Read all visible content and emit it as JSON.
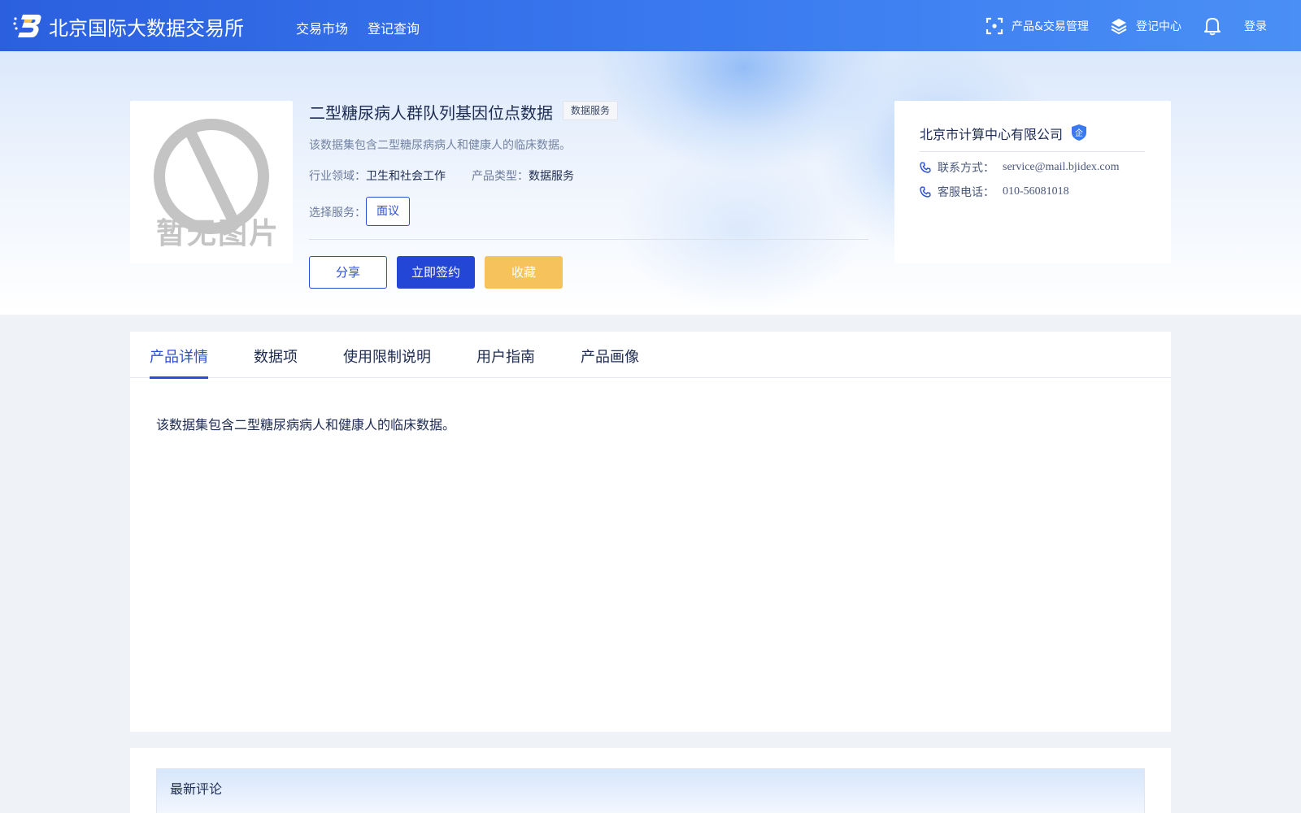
{
  "header": {
    "brand": "北京国际大数据交易所",
    "nav": [
      "交易市场",
      "登记查询"
    ],
    "right": {
      "product_mgmt": "产品&交易管理",
      "register_center": "登记中心",
      "login": "登录"
    }
  },
  "product": {
    "title": "二型糖尿病人群队列基因位点数据",
    "tag": "数据服务",
    "description": "该数据集包含二型糖尿病病人和健康人的临床数据。",
    "no_image_text": "暂无图片",
    "industry_label": "行业领域：",
    "industry_value": "卫生和社会工作",
    "type_label": "产品类型：",
    "type_value": "数据服务",
    "service_label": "选择服务：",
    "service_option": "面议",
    "buttons": {
      "share": "分享",
      "sign": "立即签约",
      "favorite": "收藏"
    }
  },
  "seller": {
    "name": "北京市计算中心有限公司",
    "badge_char": "企",
    "contact_label": "联系方式：",
    "contact_value": "service@mail.bjidex.com",
    "phone_label": "客服电话：",
    "phone_value": "010-56081018"
  },
  "tabs": {
    "items": [
      "产品详情",
      "数据项",
      "使用限制说明",
      "用户指南",
      "产品画像"
    ],
    "active_index": 0
  },
  "detail": {
    "text": "该数据集包含二型糖尿病病人和健康人的临床数据。"
  },
  "comments": {
    "title": "最新评论"
  },
  "colors": {
    "primary": "#2b4ed6",
    "nav_gradient_start": "#2b5fde",
    "nav_gradient_end": "#4a8ff5",
    "favorite": "#f5c25c",
    "text_dark": "#1d2b52",
    "text_muted": "#6c7b9c"
  },
  "icons": {
    "logo": "bjidex-logo",
    "product_mgmt": "scan-frame-icon",
    "register_center": "layers-icon",
    "notification": "bell-icon",
    "phone": "phone-icon",
    "no_image": "no-image-icon",
    "verified": "shield-badge-icon"
  }
}
